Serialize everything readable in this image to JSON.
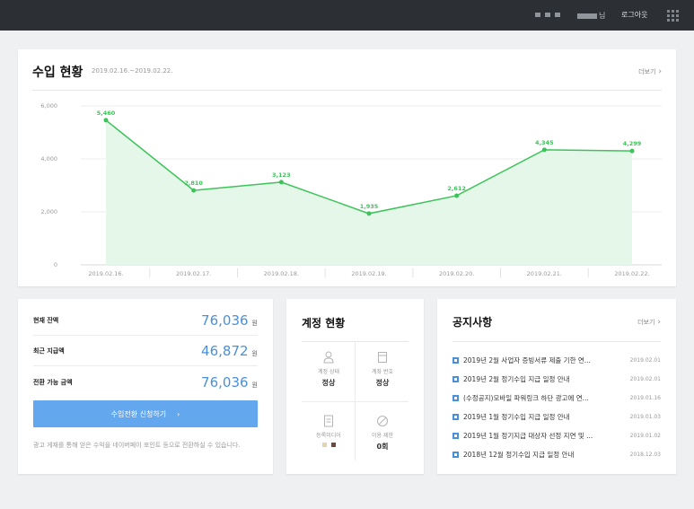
{
  "topbar": {
    "user_suffix": "님",
    "logout_label": "로그아웃",
    "menu_icon": "apps-grid-icon"
  },
  "income": {
    "title": "수입 현황",
    "date_range": "2019.02.16.~2019.02.22.",
    "more_label": "더보기",
    "more_icon": "chevron-right-icon"
  },
  "chart_data": {
    "type": "area",
    "categories": [
      "2019.02.16.",
      "2019.02.17.",
      "2019.02.18.",
      "2019.02.19.",
      "2019.02.20.",
      "2019.02.21.",
      "2019.02.22."
    ],
    "values": [
      5460,
      2810,
      3123,
      1935,
      2612,
      4345,
      4299
    ],
    "data_labels": [
      "5,460",
      "2,810",
      "3,123",
      "1,935",
      "2,612",
      "4,345",
      "4,299"
    ],
    "y_ticks": [
      "0",
      "2,000",
      "4,000",
      "6,000"
    ],
    "ylim": [
      0,
      6000
    ],
    "grid": true,
    "line_color": "#3cc45a",
    "fill_color": "#e5f7e9"
  },
  "balance": {
    "rows": [
      {
        "label": "현재 잔액",
        "value": "76,036",
        "unit": "원"
      },
      {
        "label": "최근 지급액",
        "value": "46,872",
        "unit": "원"
      },
      {
        "label": "전환 가능 금액",
        "value": "76,036",
        "unit": "원"
      }
    ],
    "button_label": "수입전환 신청하기",
    "button_icon": "chevron-right-icon",
    "note": "광고 게재를 통해 얻은 수익을 네이버페이 포인트 등으로 전환하실 수 있습니다.",
    "value_color": "#4a90d9",
    "button_color": "#63a8ef"
  },
  "account": {
    "title": "계정 현황",
    "cells": [
      {
        "icon": "person-icon",
        "caption": "계정 상태",
        "value": "정상"
      },
      {
        "icon": "card-icon",
        "caption": "계좌 번호",
        "value": "정상"
      },
      {
        "icon": "document-icon",
        "caption": "등록미디어",
        "value": ""
      },
      {
        "icon": "prohibited-icon",
        "caption": "이용 제한",
        "value": "0회"
      }
    ],
    "media_swatches": [
      "#e8d3b0",
      "#6b4a3e"
    ]
  },
  "notice": {
    "title": "공지사항",
    "more_label": "더보기",
    "items": [
      {
        "title": "2019년 2월 사업자 증빙서류 제출 기한 연...",
        "date": "2019.02.01"
      },
      {
        "title": "2019년 2월 정기수입 지급 일정 안내",
        "date": "2019.02.01"
      },
      {
        "title": "(수정공지)모바일 파워링크 하단 광고에 연...",
        "date": "2019.01.16"
      },
      {
        "title": "2019년 1월 정기수입 지급 일정 안내",
        "date": "2019.01.03"
      },
      {
        "title": "2019년 1월 정기지급 대상자 선정 지연 및 ...",
        "date": "2019.01.02"
      },
      {
        "title": "2018년 12월 정기수입 지급 일정 안내",
        "date": "2018.12.03"
      }
    ],
    "item_icon": "notice-square-icon",
    "icon_color": "#4a90d9"
  }
}
